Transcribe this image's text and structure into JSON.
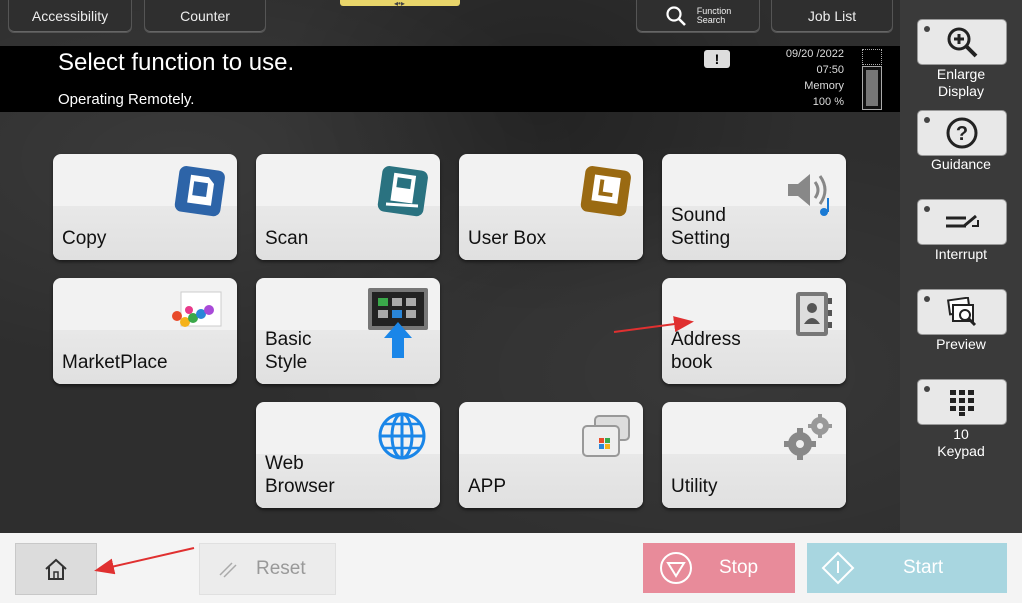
{
  "top": {
    "accessibility": "Accessibility",
    "counter": "Counter",
    "function_search_line1": "Function",
    "function_search_line2": "Search",
    "job_list": "Job List"
  },
  "message": {
    "title": "Select function to use.",
    "subtitle": "Operating Remotely.",
    "date": "09/20 /2022",
    "time": "07:50",
    "memory_label": "Memory",
    "memory_value": "100 %"
  },
  "tiles": {
    "copy": "Copy",
    "scan": "Scan",
    "user_box": "User Box",
    "sound_line1": "Sound",
    "sound_line2": "Setting",
    "marketplace": "MarketPlace",
    "basic_line1": "Basic",
    "basic_line2": "Style",
    "address_line1": "Address",
    "address_line2": "book",
    "web_line1": "Web",
    "web_line2": "Browser",
    "app": "APP",
    "utility": "Utility"
  },
  "side": {
    "enlarge_line1": "Enlarge",
    "enlarge_line2": "Display",
    "guidance": "Guidance",
    "interrupt": "Interrupt",
    "preview": "Preview",
    "keypad_line1": "10",
    "keypad_line2": "Keypad"
  },
  "bottom": {
    "reset": "Reset",
    "stop": "Stop",
    "start": "Start"
  },
  "colors": {
    "stop": "#e88b9a",
    "start": "#a8d6e0",
    "annotation_arrow": "#e03030"
  }
}
